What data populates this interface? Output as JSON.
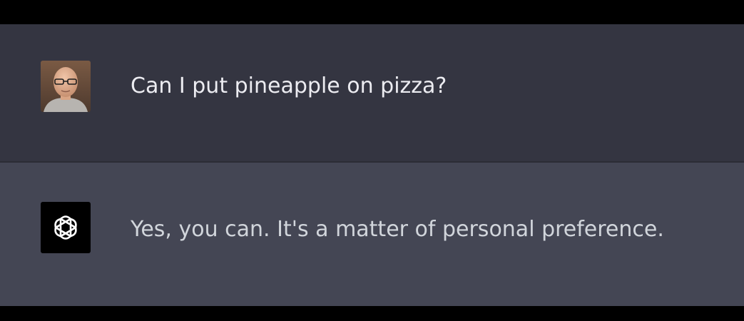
{
  "conversation": {
    "messages": [
      {
        "role": "user",
        "avatar": "user-photo-avatar",
        "text": "Can I put pineapple on pizza?"
      },
      {
        "role": "assistant",
        "avatar": "openai-logo-icon",
        "text": "Yes, you can. It's a matter of personal preference."
      }
    ]
  },
  "colors": {
    "user_row_bg": "#343541",
    "assistant_row_bg": "#444654",
    "frame_bg": "#000000",
    "text": "#ececf1"
  }
}
